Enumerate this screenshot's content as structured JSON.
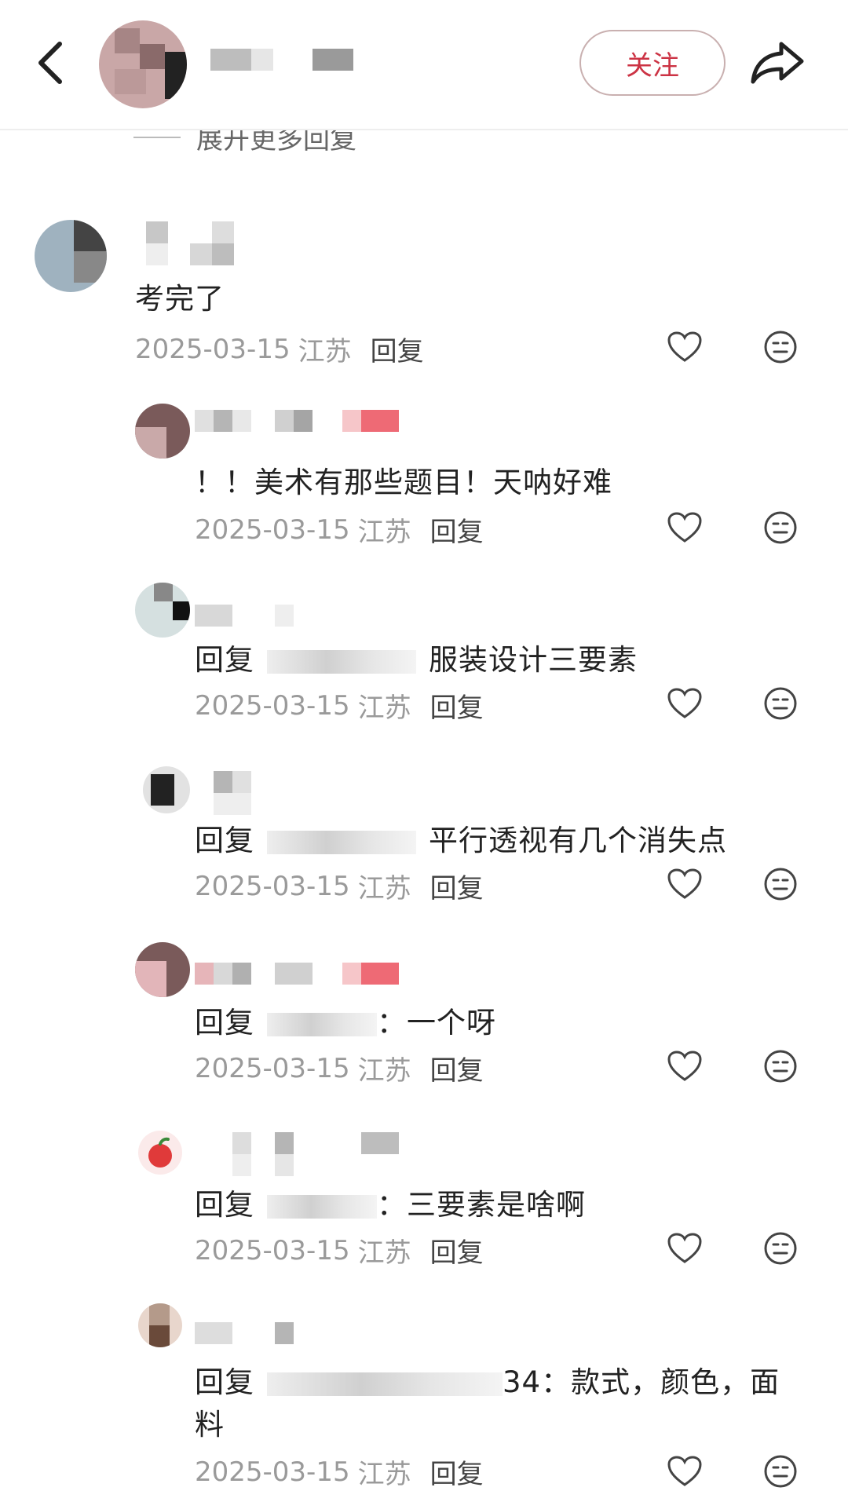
{
  "header": {
    "follow_label": "关注"
  },
  "feed": {
    "expand_more_label": "展开更多回复"
  },
  "comments": [
    {
      "text": "考完了",
      "date": "2025-03-15",
      "location": "江苏",
      "reply_label": "回复"
    },
    {
      "text": "！！美术有那些题目！天呐好难",
      "date": "2025-03-15",
      "location": "江苏",
      "reply_label": "回复"
    },
    {
      "prefix": "回复",
      "text": "服装设计三要素",
      "date": "2025-03-15",
      "location": "江苏",
      "reply_label": "回复"
    },
    {
      "prefix": "回复",
      "text": "平行透视有几个消失点",
      "date": "2025-03-15",
      "location": "江苏",
      "reply_label": "回复"
    },
    {
      "prefix": "回复",
      "text": "：一个呀",
      "date": "2025-03-15",
      "location": "江苏",
      "reply_label": "回复"
    },
    {
      "prefix": "回复",
      "text": "：三要素是啥啊",
      "date": "2025-03-15",
      "location": "江苏",
      "reply_label": "回复"
    },
    {
      "prefix": "回复",
      "text": "34：款式，颜色，面",
      "text_line2": "料",
      "date": "2025-03-15",
      "location": "江苏",
      "reply_label": "回复"
    }
  ],
  "icons": {
    "back": "chevron-left-icon",
    "share": "share-arrow-icon",
    "like": "heart-outline-icon",
    "dislike": "neutral-face-icon"
  },
  "colors": {
    "accent": "#cc3344",
    "meta_text": "#9a9a9a",
    "body_text": "#222222"
  }
}
